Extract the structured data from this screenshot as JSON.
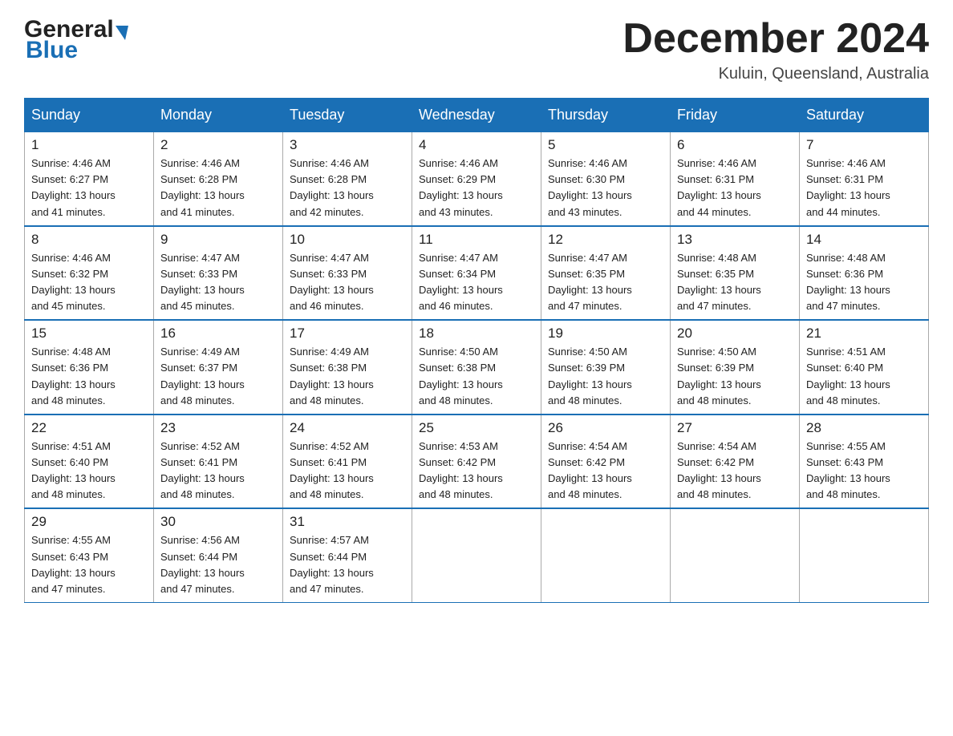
{
  "header": {
    "logo_general": "General",
    "logo_blue": "Blue",
    "month_title": "December 2024",
    "location": "Kuluin, Queensland, Australia"
  },
  "weekdays": [
    "Sunday",
    "Monday",
    "Tuesday",
    "Wednesday",
    "Thursday",
    "Friday",
    "Saturday"
  ],
  "weeks": [
    [
      {
        "day": "1",
        "sunrise": "4:46 AM",
        "sunset": "6:27 PM",
        "daylight": "13 hours and 41 minutes."
      },
      {
        "day": "2",
        "sunrise": "4:46 AM",
        "sunset": "6:28 PM",
        "daylight": "13 hours and 41 minutes."
      },
      {
        "day": "3",
        "sunrise": "4:46 AM",
        "sunset": "6:28 PM",
        "daylight": "13 hours and 42 minutes."
      },
      {
        "day": "4",
        "sunrise": "4:46 AM",
        "sunset": "6:29 PM",
        "daylight": "13 hours and 43 minutes."
      },
      {
        "day": "5",
        "sunrise": "4:46 AM",
        "sunset": "6:30 PM",
        "daylight": "13 hours and 43 minutes."
      },
      {
        "day": "6",
        "sunrise": "4:46 AM",
        "sunset": "6:31 PM",
        "daylight": "13 hours and 44 minutes."
      },
      {
        "day": "7",
        "sunrise": "4:46 AM",
        "sunset": "6:31 PM",
        "daylight": "13 hours and 44 minutes."
      }
    ],
    [
      {
        "day": "8",
        "sunrise": "4:46 AM",
        "sunset": "6:32 PM",
        "daylight": "13 hours and 45 minutes."
      },
      {
        "day": "9",
        "sunrise": "4:47 AM",
        "sunset": "6:33 PM",
        "daylight": "13 hours and 45 minutes."
      },
      {
        "day": "10",
        "sunrise": "4:47 AM",
        "sunset": "6:33 PM",
        "daylight": "13 hours and 46 minutes."
      },
      {
        "day": "11",
        "sunrise": "4:47 AM",
        "sunset": "6:34 PM",
        "daylight": "13 hours and 46 minutes."
      },
      {
        "day": "12",
        "sunrise": "4:47 AM",
        "sunset": "6:35 PM",
        "daylight": "13 hours and 47 minutes."
      },
      {
        "day": "13",
        "sunrise": "4:48 AM",
        "sunset": "6:35 PM",
        "daylight": "13 hours and 47 minutes."
      },
      {
        "day": "14",
        "sunrise": "4:48 AM",
        "sunset": "6:36 PM",
        "daylight": "13 hours and 47 minutes."
      }
    ],
    [
      {
        "day": "15",
        "sunrise": "4:48 AM",
        "sunset": "6:36 PM",
        "daylight": "13 hours and 48 minutes."
      },
      {
        "day": "16",
        "sunrise": "4:49 AM",
        "sunset": "6:37 PM",
        "daylight": "13 hours and 48 minutes."
      },
      {
        "day": "17",
        "sunrise": "4:49 AM",
        "sunset": "6:38 PM",
        "daylight": "13 hours and 48 minutes."
      },
      {
        "day": "18",
        "sunrise": "4:50 AM",
        "sunset": "6:38 PM",
        "daylight": "13 hours and 48 minutes."
      },
      {
        "day": "19",
        "sunrise": "4:50 AM",
        "sunset": "6:39 PM",
        "daylight": "13 hours and 48 minutes."
      },
      {
        "day": "20",
        "sunrise": "4:50 AM",
        "sunset": "6:39 PM",
        "daylight": "13 hours and 48 minutes."
      },
      {
        "day": "21",
        "sunrise": "4:51 AM",
        "sunset": "6:40 PM",
        "daylight": "13 hours and 48 minutes."
      }
    ],
    [
      {
        "day": "22",
        "sunrise": "4:51 AM",
        "sunset": "6:40 PM",
        "daylight": "13 hours and 48 minutes."
      },
      {
        "day": "23",
        "sunrise": "4:52 AM",
        "sunset": "6:41 PM",
        "daylight": "13 hours and 48 minutes."
      },
      {
        "day": "24",
        "sunrise": "4:52 AM",
        "sunset": "6:41 PM",
        "daylight": "13 hours and 48 minutes."
      },
      {
        "day": "25",
        "sunrise": "4:53 AM",
        "sunset": "6:42 PM",
        "daylight": "13 hours and 48 minutes."
      },
      {
        "day": "26",
        "sunrise": "4:54 AM",
        "sunset": "6:42 PM",
        "daylight": "13 hours and 48 minutes."
      },
      {
        "day": "27",
        "sunrise": "4:54 AM",
        "sunset": "6:42 PM",
        "daylight": "13 hours and 48 minutes."
      },
      {
        "day": "28",
        "sunrise": "4:55 AM",
        "sunset": "6:43 PM",
        "daylight": "13 hours and 48 minutes."
      }
    ],
    [
      {
        "day": "29",
        "sunrise": "4:55 AM",
        "sunset": "6:43 PM",
        "daylight": "13 hours and 47 minutes."
      },
      {
        "day": "30",
        "sunrise": "4:56 AM",
        "sunset": "6:44 PM",
        "daylight": "13 hours and 47 minutes."
      },
      {
        "day": "31",
        "sunrise": "4:57 AM",
        "sunset": "6:44 PM",
        "daylight": "13 hours and 47 minutes."
      },
      null,
      null,
      null,
      null
    ]
  ],
  "labels": {
    "sunrise_prefix": "Sunrise: ",
    "sunset_prefix": "Sunset: ",
    "daylight_prefix": "Daylight: "
  }
}
